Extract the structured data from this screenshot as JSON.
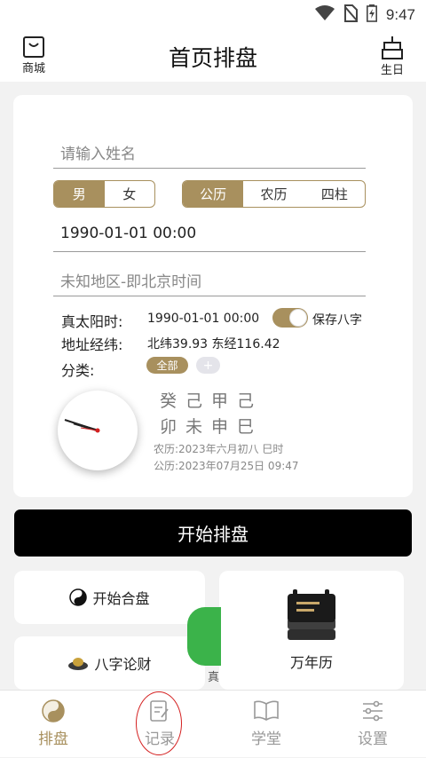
{
  "status_bar": {
    "time": "9:47"
  },
  "header": {
    "title": "首页排盘",
    "left_label": "商城",
    "right_label": "生日"
  },
  "form": {
    "name_placeholder": "请输入姓名",
    "gender_options": [
      "男",
      "女"
    ],
    "calendar_options": [
      "公历",
      "农历",
      "四柱"
    ],
    "datetime_value": "1990-01-01 00:00",
    "location_value": "未知地区-即北京时间",
    "solar_time_label": "真太阳时:",
    "solar_time_value": "1990-01-01 00:00",
    "save_label": "保存八字",
    "coords_label": "地址经纬:",
    "coords_value": "北纬39.93 东经116.42",
    "category_label": "分类:",
    "category_chip_all": "全部",
    "category_chip_add": "+"
  },
  "bazi": {
    "row1": "癸己甲己",
    "row2": "卯未申巳",
    "lunar_line": "农历:2023年六月初八 巳时",
    "solar_line": "公历:2023年07月25日 09:47"
  },
  "start_button": "开始排盘",
  "tiles": {
    "hepan": "开始合盘",
    "lunci": "八字论财",
    "wannianli": "万年历",
    "partial_text": "真"
  },
  "bottom_nav": [
    "排盘",
    "记录",
    "学堂",
    "设置"
  ],
  "colors": {
    "accent": "#a8905e",
    "annotation": "#d42020"
  }
}
